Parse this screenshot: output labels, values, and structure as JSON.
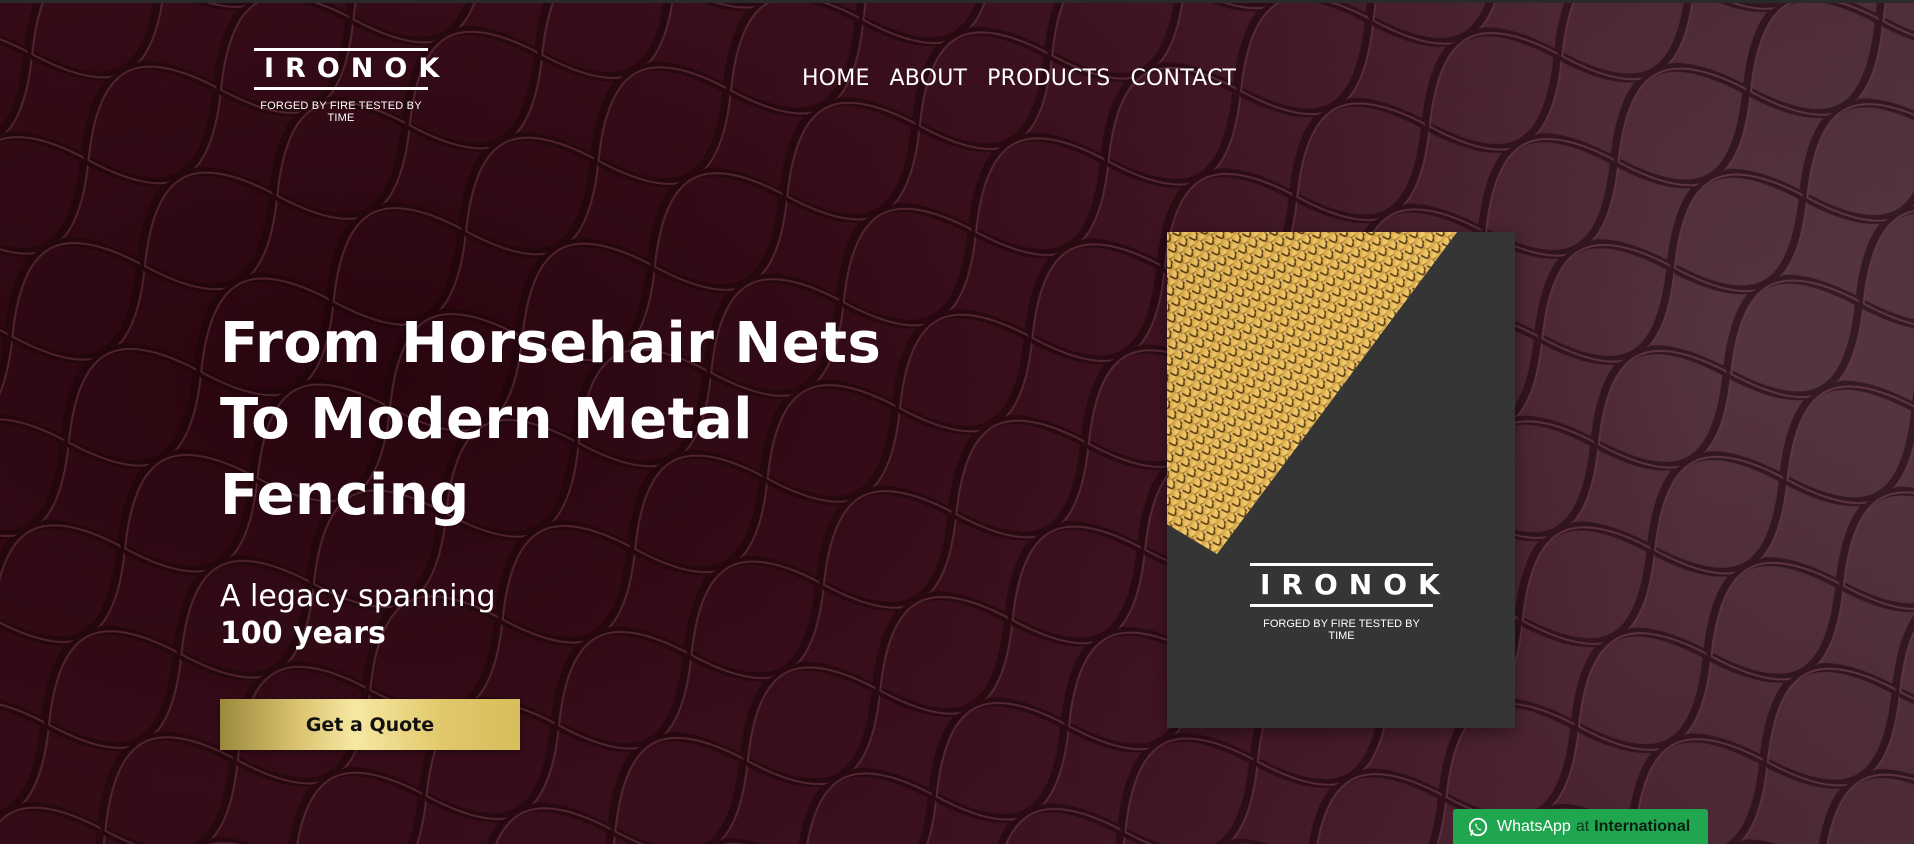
{
  "brand": {
    "name": "IRONOK",
    "tagline": "FORGED BY FIRE TESTED BY TIME"
  },
  "nav": {
    "items": [
      "HOME",
      "ABOUT",
      "PRODUCTS",
      "CONTACT"
    ]
  },
  "hero": {
    "headline": "From Horsehair Nets To Modern Metal Fencing",
    "subline": "A legacy spanning",
    "subline_bold": "100 years",
    "cta_label": "Get a Quote"
  },
  "product_card": {
    "brand": "IRONOK",
    "tagline": "FORGED BY FIRE TESTED BY TIME"
  },
  "whatsapp": {
    "label": "WhatsApp",
    "at": "at",
    "region": "International"
  },
  "colors": {
    "background": "#3a121e",
    "cta_gold": "#e1c76a",
    "card_bg": "#353535",
    "whatsapp_green": "#1fa64f"
  },
  "icons": [
    "whatsapp-icon"
  ]
}
